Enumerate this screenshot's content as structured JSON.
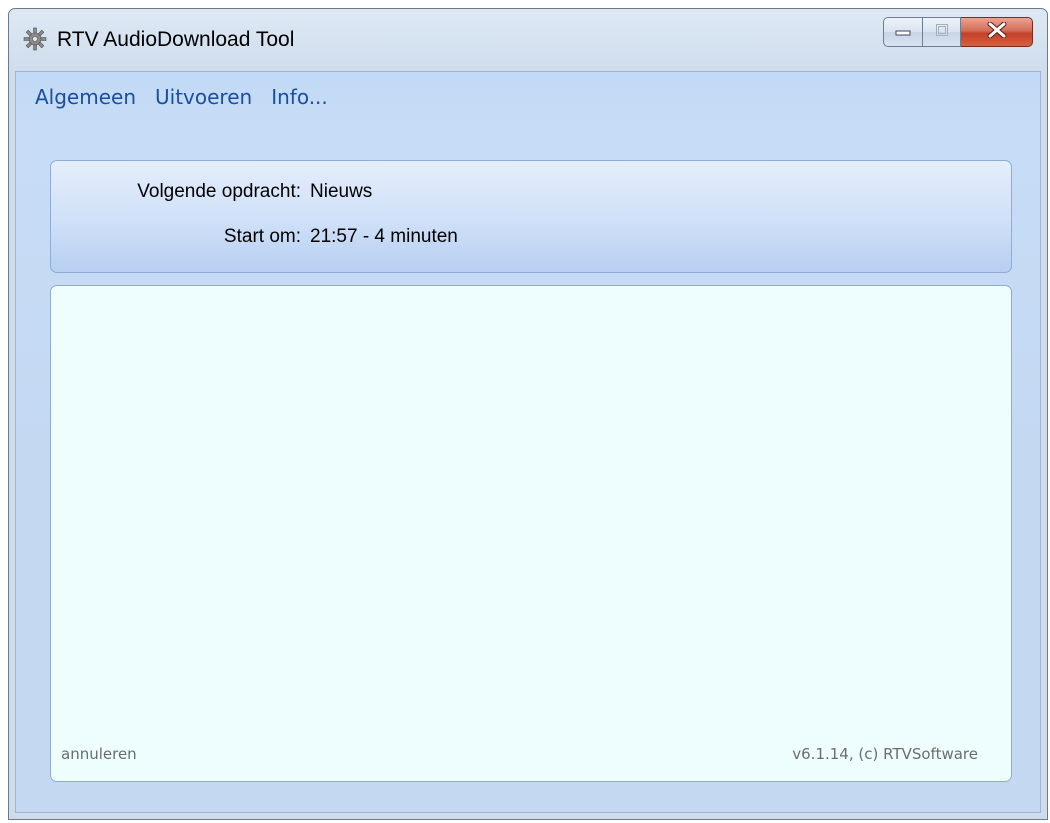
{
  "window": {
    "title": "RTV AudioDownload Tool",
    "icon": "gear-icon"
  },
  "caption": {
    "minimize_icon": "minimize-icon",
    "maximize_icon": "maximize-icon",
    "close_icon": "close-icon"
  },
  "menu": {
    "items": [
      {
        "label": "Algemeen"
      },
      {
        "label": "Uitvoeren"
      },
      {
        "label": "Info..."
      }
    ]
  },
  "status": {
    "next_job_label": "Volgende opdracht:",
    "next_job_value": "Nieuws",
    "start_label": "Start om:",
    "start_value": "21:57 - 4 minuten"
  },
  "footer": {
    "cancel_label": "annuleren",
    "version": "v6.1.14, (c) RTVSoftware"
  },
  "colors": {
    "menu_text": "#1a4fa0",
    "log_background": "#eefeff",
    "close_button": "#c2412a"
  }
}
